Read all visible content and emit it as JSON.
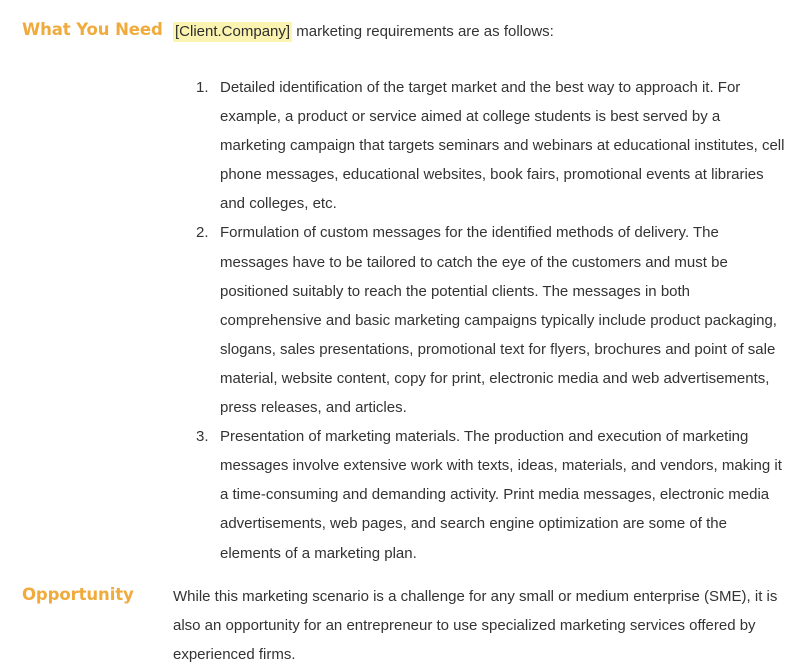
{
  "document": {
    "background_color": "#ffffff",
    "text_color": "#333333",
    "heading_color": "#f0ab3c",
    "highlight_color": "#fbf3b0"
  },
  "sections": {
    "what_you_need": {
      "heading": "What You Need",
      "intro": {
        "merge_token": "[Client.Company]",
        "text": " marketing requirements are as follows:"
      },
      "requirements": [
        {
          "number": "1.",
          "text": "Detailed identification of the target market and the best way to approach it. For example, a product or service aimed at college students is best served by a marketing campaign that targets seminars and webinars at educational institutes, cell phone messages, educational websites, book fairs, promotional events at libraries and colleges, etc."
        },
        {
          "number": "2.",
          "text": "Formulation of custom messages for the identified methods of delivery. The messages have to be tailored to catch the eye of the customers and must be positioned suitably to reach the potential clients. The messages in both comprehensive and basic marketing campaigns typically include product packaging, slogans, sales presentations, promotional text for flyers, brochures and point of sale material, website content, copy for print, electronic media and web advertisements, press releases, and articles."
        },
        {
          "number": "3.",
          "text": "Presentation of marketing materials. The production and execution of marketing messages involve extensive work with texts, ideas, materials, and vendors, making it a time-consuming and demanding activity. Print media messages, electronic media advertisements, web pages, and search engine optimization are some of the elements of a marketing plan."
        }
      ]
    },
    "opportunity": {
      "heading": "Opportunity",
      "paragraph": "While this marketing scenario is a challenge for any small or medium enterprise (SME), it is also an opportunity for an entrepreneur to use specialized marketing services offered by experienced firms."
    }
  }
}
